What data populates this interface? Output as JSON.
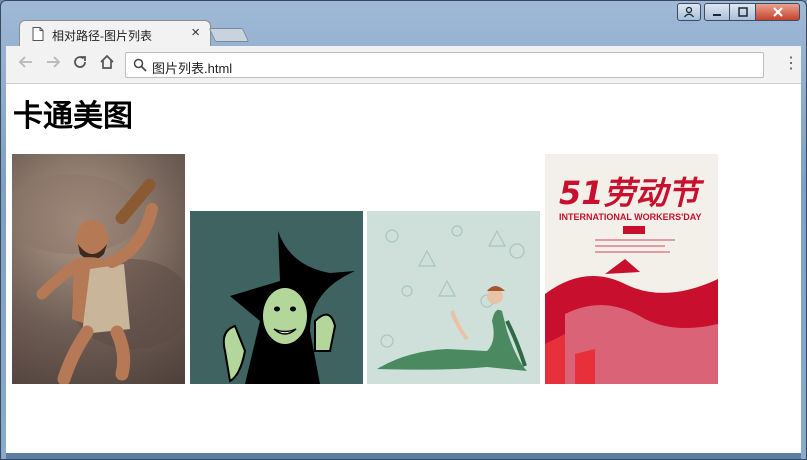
{
  "browser": {
    "tab_title": "相对路径-图片列表",
    "tab_close": "×",
    "address_url": "图片列表.html",
    "menu_glyph": "⋮"
  },
  "page": {
    "heading": "卡通美图",
    "images": [
      {
        "name": "caveman-cartoon",
        "alt_icon": "caveman-image"
      },
      {
        "name": "witch-cartoon",
        "alt_icon": "witch-image"
      },
      {
        "name": "vintage-lady-illustration",
        "alt_icon": "lady-image"
      },
      {
        "name": "labor-day-poster",
        "alt_icon": "poster-image",
        "poster_title": "51劳动节",
        "poster_subtitle": "INTERNATIONAL WORKERS'DAY"
      }
    ]
  },
  "icons": [
    "document-icon",
    "close-icon",
    "back-arrow-icon",
    "forward-arrow-icon",
    "reload-icon",
    "home-icon",
    "search-icon",
    "menu-dots-icon",
    "user-icon",
    "minimize-icon",
    "maximize-icon",
    "window-close-icon"
  ],
  "colors": {
    "titlebar": "#8aaacc",
    "tab": "#f2f2f2",
    "poster_red": "#c8102e"
  }
}
